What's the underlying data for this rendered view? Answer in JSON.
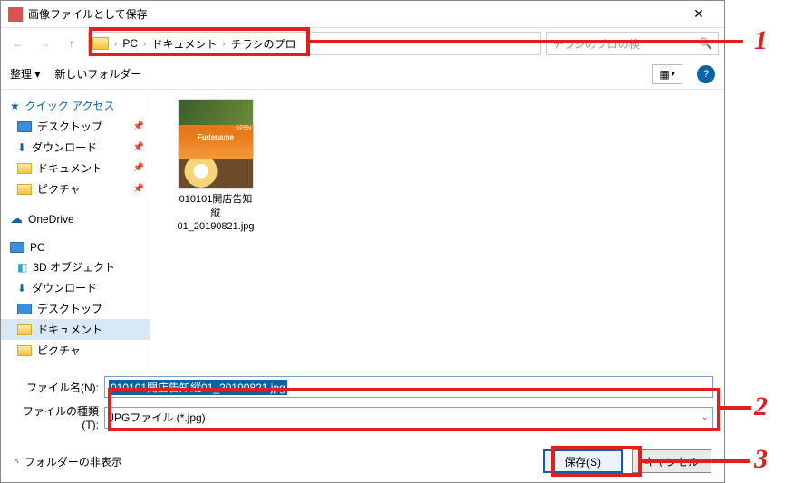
{
  "titlebar": {
    "title": "画像ファイルとして保存"
  },
  "breadcrumb": {
    "pc": "PC",
    "documents": "ドキュメント",
    "folder": "チラシのプロ"
  },
  "search": {
    "placeholder": "チラシのプロの検"
  },
  "toolbar": {
    "organize": "整理 ▾",
    "new_folder": "新しいフォルダー"
  },
  "tree": {
    "quick_access": "クイック アクセス",
    "desktop": "デスクトップ",
    "downloads": "ダウンロード",
    "documents": "ドキュメント",
    "pictures": "ピクチャ",
    "onedrive": "OneDrive",
    "pc": "PC",
    "objects3d": "3D オブジェクト",
    "downloads2": "ダウンロード",
    "desktop2": "デスクトップ",
    "documents2": "ドキュメント",
    "pictures2": "ピクチャ"
  },
  "file": {
    "thumb_badge": "OPEN",
    "thumb_brand": "Fudename",
    "name_line1": "010101開店告知",
    "name_line2": "縦",
    "name_line3": "01_20190821.jpg"
  },
  "fields": {
    "filename_label": "ファイル名(N):",
    "filename_value": "010101開店告知縦01_20190821.jpg",
    "filetype_label": "ファイルの種類(T):",
    "filetype_value": "JPGファイル (*.jpg)"
  },
  "footer": {
    "hide_folders": "フォルダーの非表示",
    "save": "保存(S)",
    "cancel": "キャンセル"
  },
  "callouts": {
    "n1": "1",
    "n2": "2",
    "n3": "3"
  }
}
